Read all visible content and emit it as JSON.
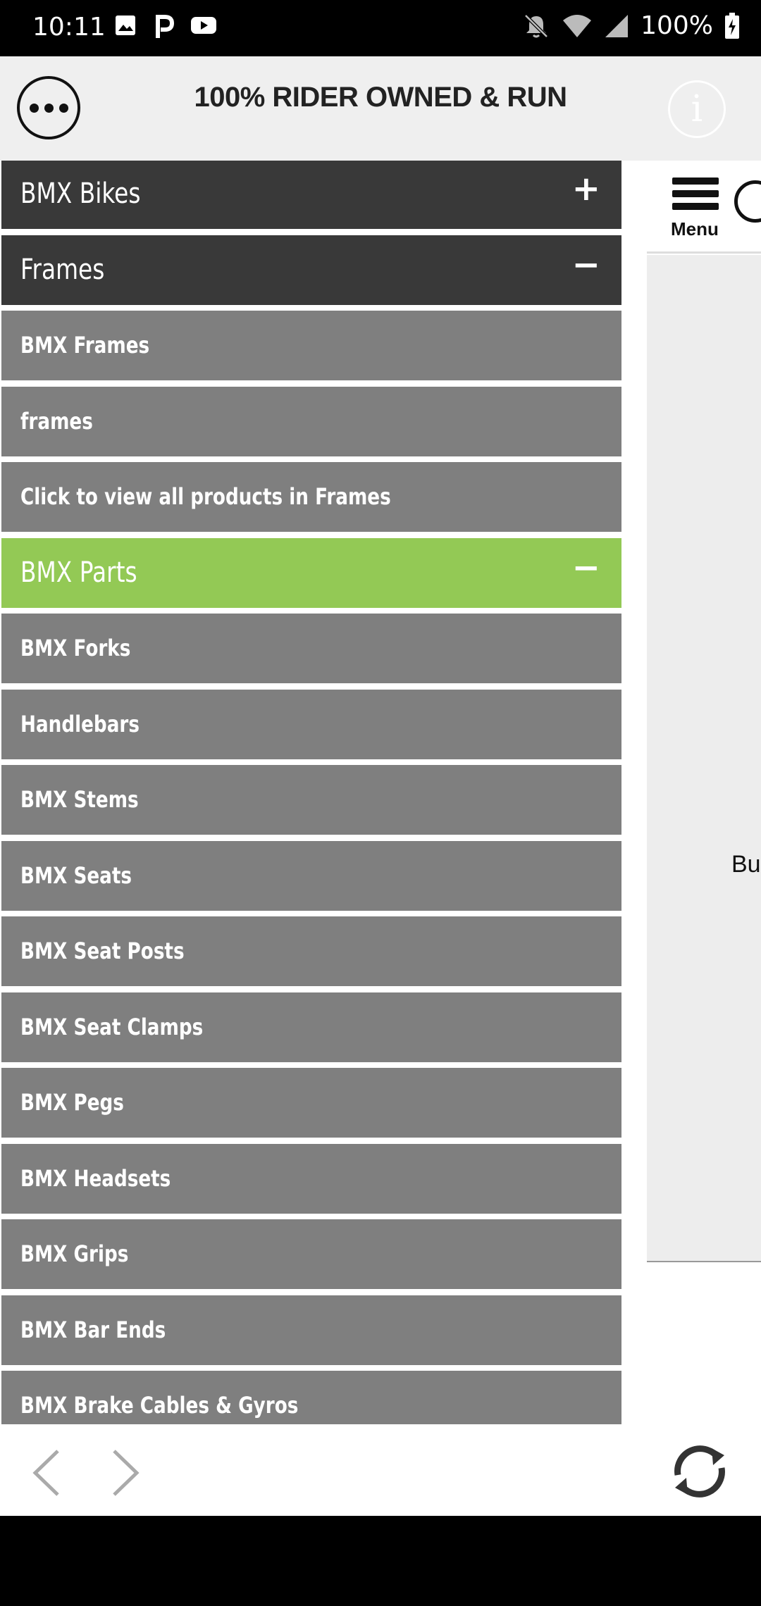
{
  "status_bar": {
    "time": "10:11",
    "battery": "100%",
    "left_icons": [
      "image-icon",
      "p-app-icon",
      "youtube-icon"
    ],
    "right_icons": [
      "notifications-off-icon",
      "wifi-icon",
      "signal-icon",
      "battery-charging-icon"
    ]
  },
  "header": {
    "title": "100% RIDER OWNED & RUN",
    "more_icon": "more-icon",
    "info_label": "i"
  },
  "page": {
    "menu_label": "Menu",
    "body_text": "Bu"
  },
  "drawer": {
    "items": [
      {
        "label": "BMX Bikes",
        "style": "dark",
        "toggle": "+"
      },
      {
        "label": "Frames",
        "style": "dark",
        "toggle": "−"
      },
      {
        "label": "BMX Frames",
        "style": "grey"
      },
      {
        "label": "frames",
        "style": "grey"
      },
      {
        "label": "Click to view all products in Frames",
        "style": "grey"
      },
      {
        "label": "BMX Parts",
        "style": "green",
        "toggle": "−"
      },
      {
        "label": "BMX Forks",
        "style": "grey"
      },
      {
        "label": "Handlebars",
        "style": "grey"
      },
      {
        "label": "BMX Stems",
        "style": "grey"
      },
      {
        "label": "BMX Seats",
        "style": "grey"
      },
      {
        "label": "BMX Seat Posts",
        "style": "grey"
      },
      {
        "label": "BMX Seat Clamps",
        "style": "grey"
      },
      {
        "label": "BMX Pegs",
        "style": "grey"
      },
      {
        "label": "BMX Headsets",
        "style": "grey"
      },
      {
        "label": "BMX Grips",
        "style": "grey"
      },
      {
        "label": "BMX Bar Ends",
        "style": "grey"
      },
      {
        "label": "BMX Brake Cables & Gyros",
        "style": "grey"
      }
    ]
  },
  "colors": {
    "accent_green": "#93c955",
    "dark_row": "#393939",
    "grey_row": "#7f7f7f"
  }
}
